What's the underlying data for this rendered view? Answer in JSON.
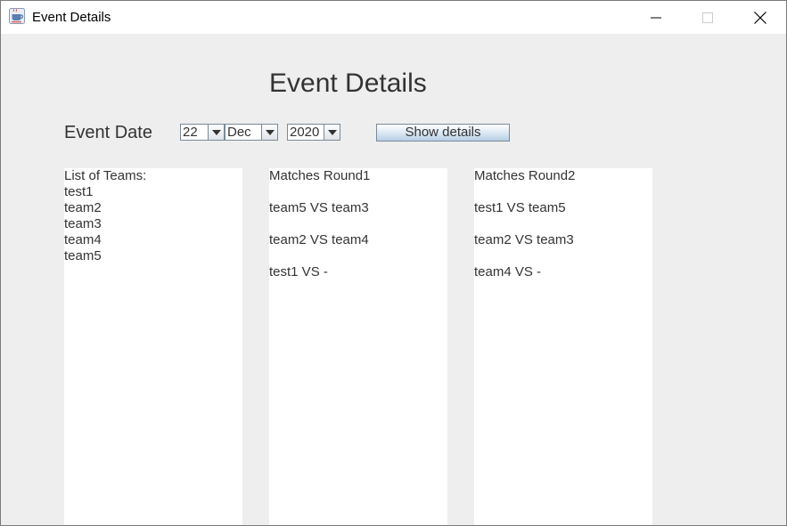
{
  "window": {
    "title": "Event Details"
  },
  "heading": "Event Details",
  "date_label": "Event Date",
  "date": {
    "day": "22",
    "month": "Dec",
    "year": "2020"
  },
  "show_button_label": "Show details",
  "teams_panel": {
    "header": "List of Teams:",
    "teams": [
      "test1",
      "team2",
      "team3",
      "team4",
      "team5"
    ]
  },
  "round1_panel": {
    "header": "Matches Round1",
    "matches": [
      "team5 VS team3",
      "team2 VS team4",
      "test1 VS -"
    ]
  },
  "round2_panel": {
    "header": "Matches Round2",
    "matches": [
      "test1 VS team5",
      "team2 VS team3",
      "team4 VS -"
    ]
  },
  "icons": {
    "app": "java-coffee-cup-icon",
    "minimize": "minimize-icon",
    "maximize": "maximize-icon",
    "close": "close-icon"
  }
}
